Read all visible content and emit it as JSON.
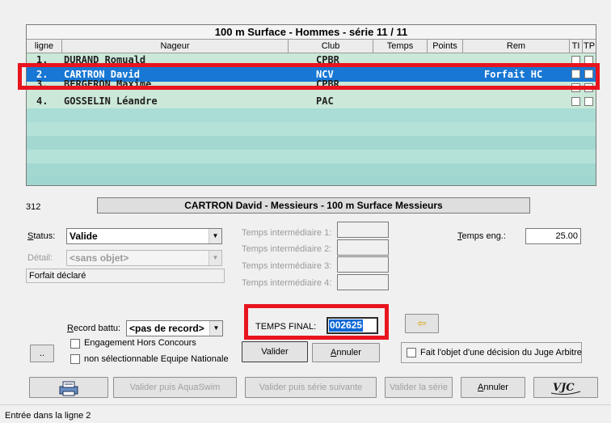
{
  "grid": {
    "title": "100 m Surface - Hommes - série 11 / 11",
    "columns": [
      "ligne",
      "Nageur",
      "Club",
      "Temps",
      "Points",
      "Rem",
      "TI",
      "TP"
    ],
    "rows": [
      {
        "ligne": "1.",
        "nageur": "DURAND Romuald",
        "club": "CPBR",
        "rem": ""
      },
      {
        "ligne": "2.",
        "nageur": "CARTRON David",
        "club": "NCV",
        "rem": "Forfait HC"
      },
      {
        "ligne": "3.",
        "nageur": "BERGERON Maxime",
        "club": "CPBR",
        "rem": ""
      },
      {
        "ligne": "4.",
        "nageur": "GOSSELIN Léandre",
        "club": "PAC",
        "rem": ""
      }
    ]
  },
  "detail": {
    "number": "312",
    "banner": "CARTRON David  -  Messieurs  -  100 m Surface Messieurs",
    "status_label": "Status:",
    "status_value": "Valide",
    "detail_label": "Détail:",
    "detail_value": "<sans objet>",
    "forfait_text": "Forfait déclaré",
    "interm_labels": [
      "Temps intermédiaire 1:",
      "Temps intermédiaire 2:",
      "Temps intermédiaire 3:",
      "Temps intermédiaire 4:"
    ],
    "temps_eng_label": "Temps eng.:",
    "temps_eng_value": "25.00",
    "record_label": "Record battu:",
    "record_value": "<pas de record>",
    "temps_final_label": "TEMPS FINAL:",
    "temps_final_value": "002625",
    "arrow_button": "⇦",
    "engagement_hc": "Engagement Hors Concours",
    "non_select": "non sélectionnable Equipe Nationale",
    "dot_button": "..",
    "valider": "Valider",
    "annuler": "Annuler",
    "juge_arbitre": "Fait l'objet d'une décision du Juge Arbitre"
  },
  "bottom": {
    "aquaswim": "Valider puis AquaSwim",
    "serie_suivante": "Valider puis série suivante",
    "valider_serie": "Valider la série",
    "annuler": "Annuler",
    "logo_text": "VJC"
  },
  "status_bar": "Entrée dans la ligne 2",
  "colors": {
    "selected": "#1877d4",
    "grid_bg": "#9fd6cf",
    "highlight": "#e8141e"
  }
}
